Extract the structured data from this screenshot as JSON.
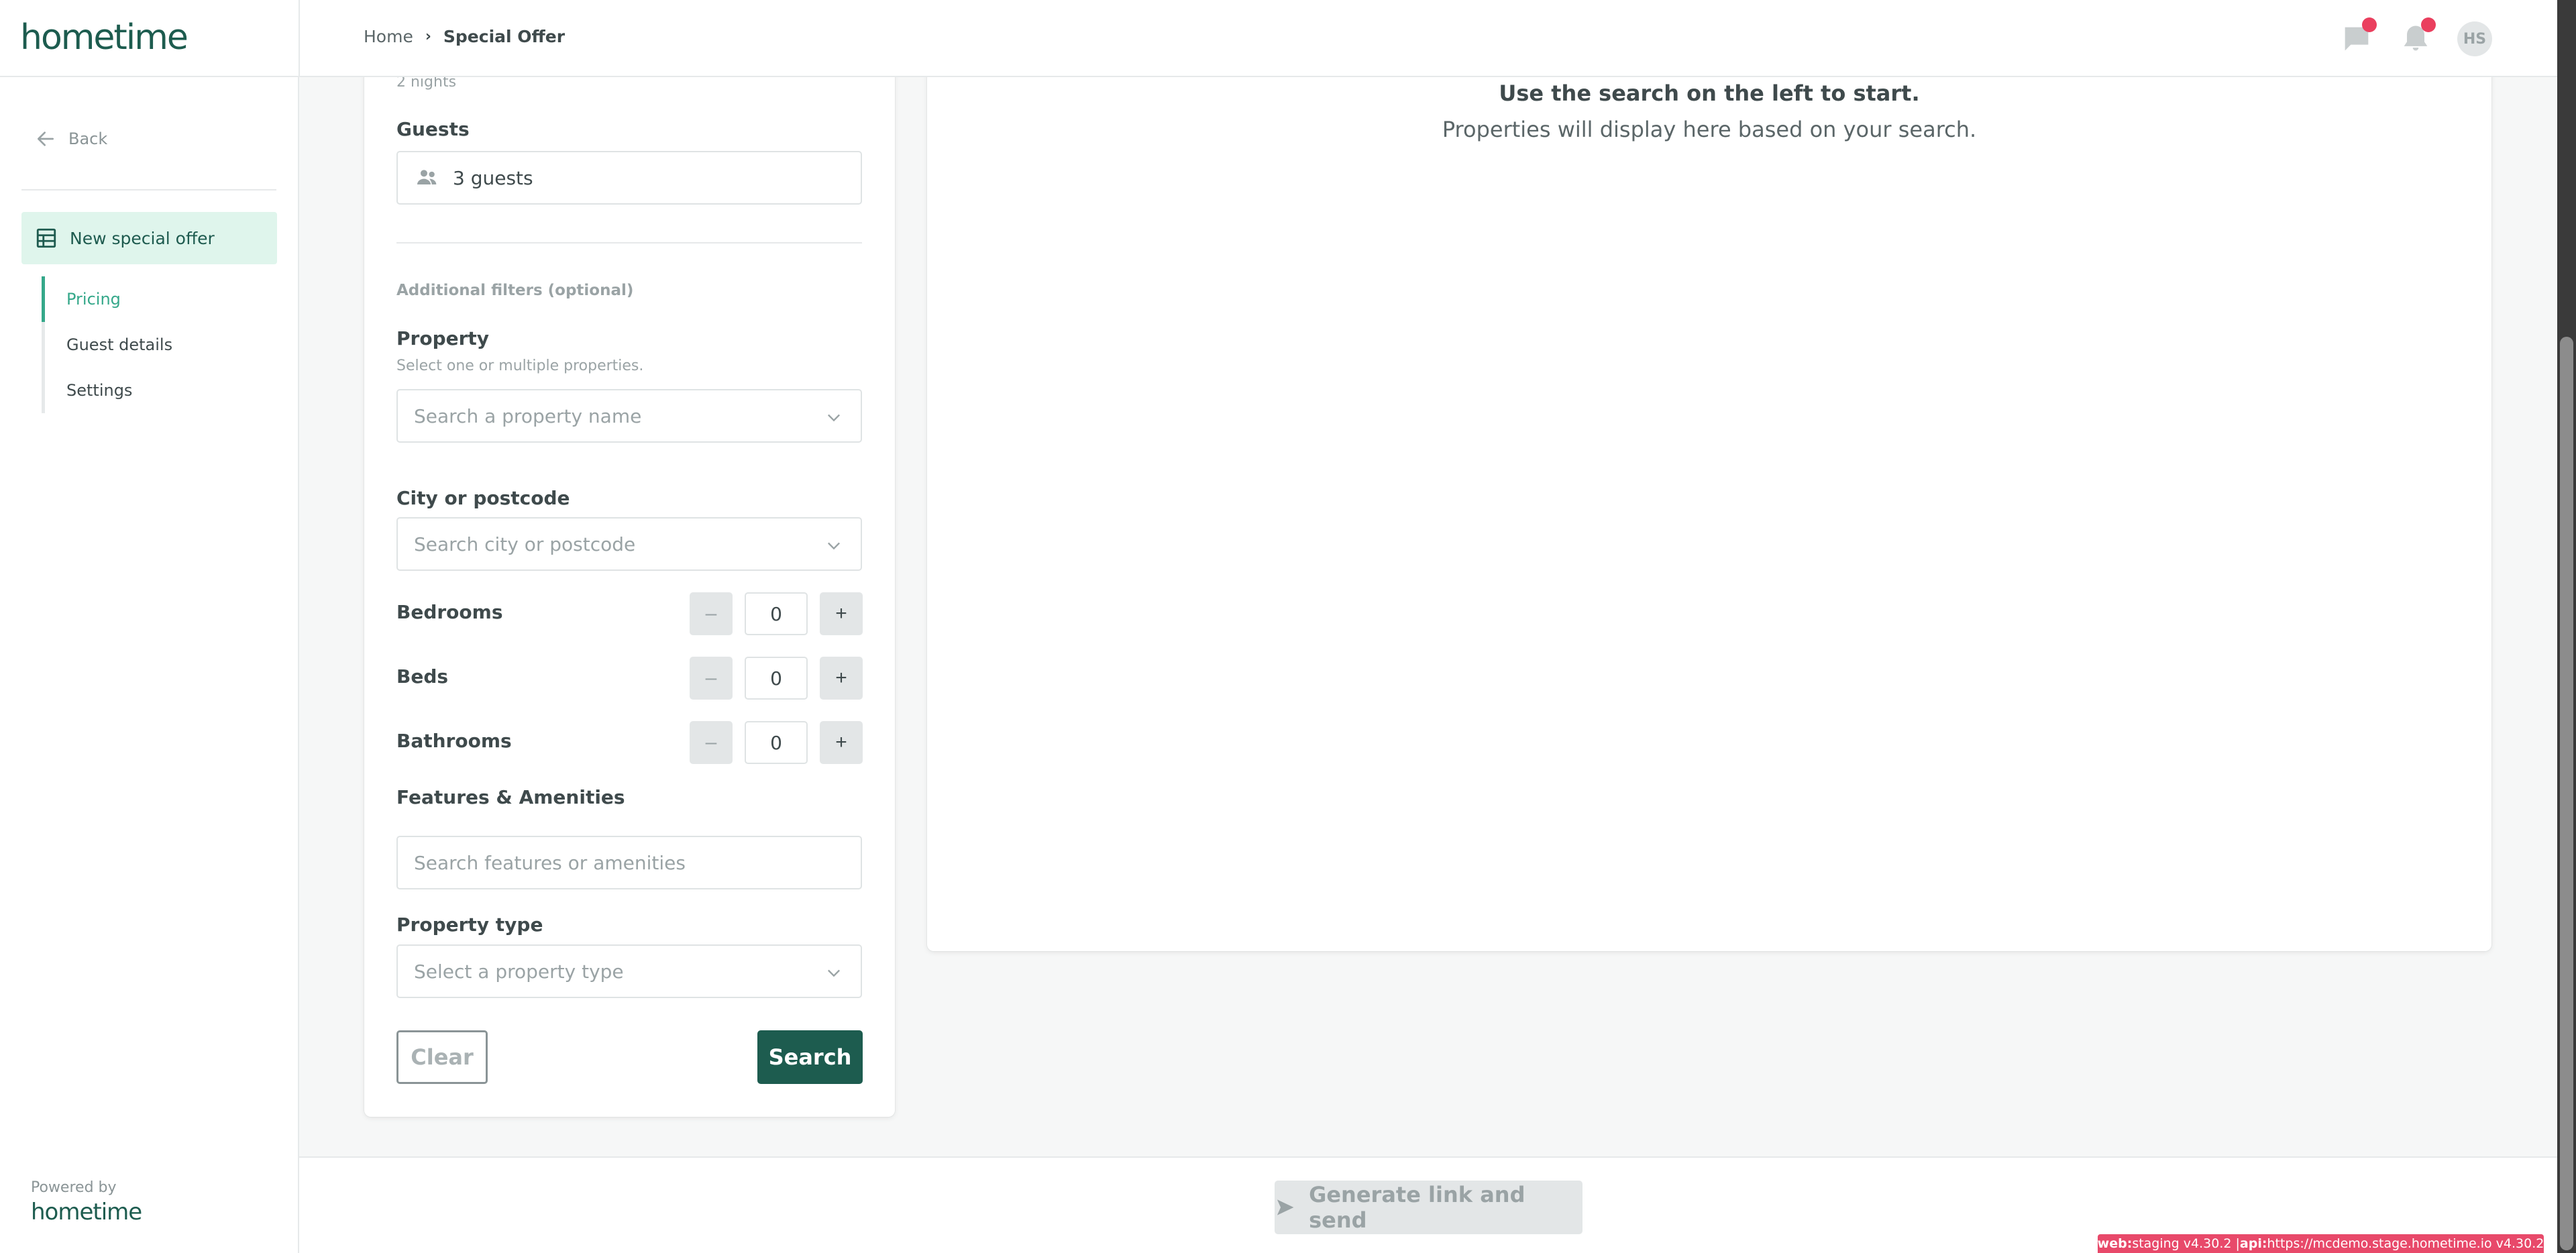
{
  "app": {
    "logo": "hometime"
  },
  "breadcrumb": {
    "home": "Home",
    "current": "Special Offer"
  },
  "header": {
    "avatar_initials": "HS",
    "icons": [
      "chat-icon",
      "bell-icon"
    ],
    "badge_color": "#ea3f5e"
  },
  "sidebar": {
    "back_label": "Back",
    "active_item": "New special offer",
    "sub_items": [
      {
        "label": "Pricing",
        "active": true
      },
      {
        "label": "Guest details",
        "active": false
      },
      {
        "label": "Settings",
        "active": false
      }
    ],
    "powered_by_label": "Powered by",
    "powered_by_logo": "hometime"
  },
  "form": {
    "nights": "2 nights",
    "guests_label": "Guests",
    "guests_value": "3 guests",
    "additional_filters": "Additional filters (optional)",
    "property_label": "Property",
    "property_hint": "Select one or multiple properties.",
    "property_placeholder": "Search a property name",
    "city_label": "City or postcode",
    "city_placeholder": "Search city or postcode",
    "steppers": [
      {
        "label": "Bedrooms",
        "value": "0"
      },
      {
        "label": "Beds",
        "value": "0"
      },
      {
        "label": "Bathrooms",
        "value": "0"
      }
    ],
    "stepper_minus": "–",
    "stepper_plus": "+",
    "features_label": "Features & Amenities",
    "features_placeholder": "Search features or amenities",
    "property_type_label": "Property type",
    "property_type_placeholder": "Select a property type",
    "clear_label": "Clear",
    "search_label": "Search"
  },
  "results": {
    "title": "Use the search on the left to start.",
    "subtitle": "Properties will display here based on your search."
  },
  "footer": {
    "generate_label": "Generate link and send"
  },
  "env": {
    "web_key": "web:",
    "web_value": " staging v4.30.2 | ",
    "api_key": "api:",
    "api_value": "https://mcdemo.stage.hometime.io v4.30.2"
  },
  "colors": {
    "brand": "#1d5c4f",
    "accent": "#35a88a",
    "active_bg": "#dff5ec",
    "env_badge": "#e8496a"
  }
}
